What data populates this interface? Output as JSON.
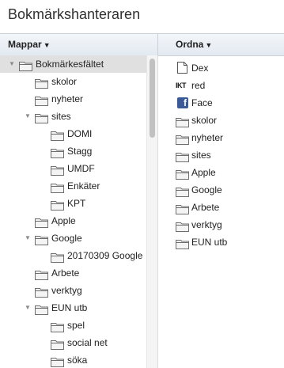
{
  "title": "Bokmärkshanteraren",
  "header": {
    "folders_label": "Mappar",
    "organize_label": "Ordna"
  },
  "tree": [
    {
      "label": "Bokmärkesfältet",
      "twisty": "down",
      "level": 0,
      "selected": true
    },
    {
      "label": "skolor",
      "twisty": "",
      "level": 1
    },
    {
      "label": "nyheter",
      "twisty": "",
      "level": 1
    },
    {
      "label": "sites",
      "twisty": "down",
      "level": 1
    },
    {
      "label": "DOMI",
      "twisty": "",
      "level": 2
    },
    {
      "label": "Stagg",
      "twisty": "",
      "level": 2
    },
    {
      "label": "UMDF",
      "twisty": "",
      "level": 2
    },
    {
      "label": "Enkäter",
      "twisty": "",
      "level": 2
    },
    {
      "label": "KPT",
      "twisty": "",
      "level": 2
    },
    {
      "label": "Apple",
      "twisty": "",
      "level": 1
    },
    {
      "label": "Google",
      "twisty": "down",
      "level": 1
    },
    {
      "label": "20170309 Google",
      "twisty": "",
      "level": 2
    },
    {
      "label": "Arbete",
      "twisty": "",
      "level": 1
    },
    {
      "label": "verktyg",
      "twisty": "",
      "level": 1
    },
    {
      "label": "EUN utb",
      "twisty": "down",
      "level": 1
    },
    {
      "label": "spel",
      "twisty": "",
      "level": 2
    },
    {
      "label": "social net",
      "twisty": "",
      "level": 2
    },
    {
      "label": "söka",
      "twisty": "",
      "level": 2
    }
  ],
  "list": [
    {
      "label": "Dex",
      "icon": "document-icon"
    },
    {
      "label": "red",
      "icon": "ikt-favicon",
      "icon_text": "IKT"
    },
    {
      "label": "Face",
      "icon": "facebook-favicon",
      "icon_text": "f"
    },
    {
      "label": "skolor",
      "icon": "folder-icon"
    },
    {
      "label": "nyheter",
      "icon": "folder-icon"
    },
    {
      "label": "sites",
      "icon": "folder-icon"
    },
    {
      "label": "Apple",
      "icon": "folder-icon"
    },
    {
      "label": "Google",
      "icon": "folder-icon"
    },
    {
      "label": "Arbete",
      "icon": "folder-icon"
    },
    {
      "label": "verktyg",
      "icon": "folder-icon"
    },
    {
      "label": "EUN utb",
      "icon": "folder-icon"
    }
  ]
}
